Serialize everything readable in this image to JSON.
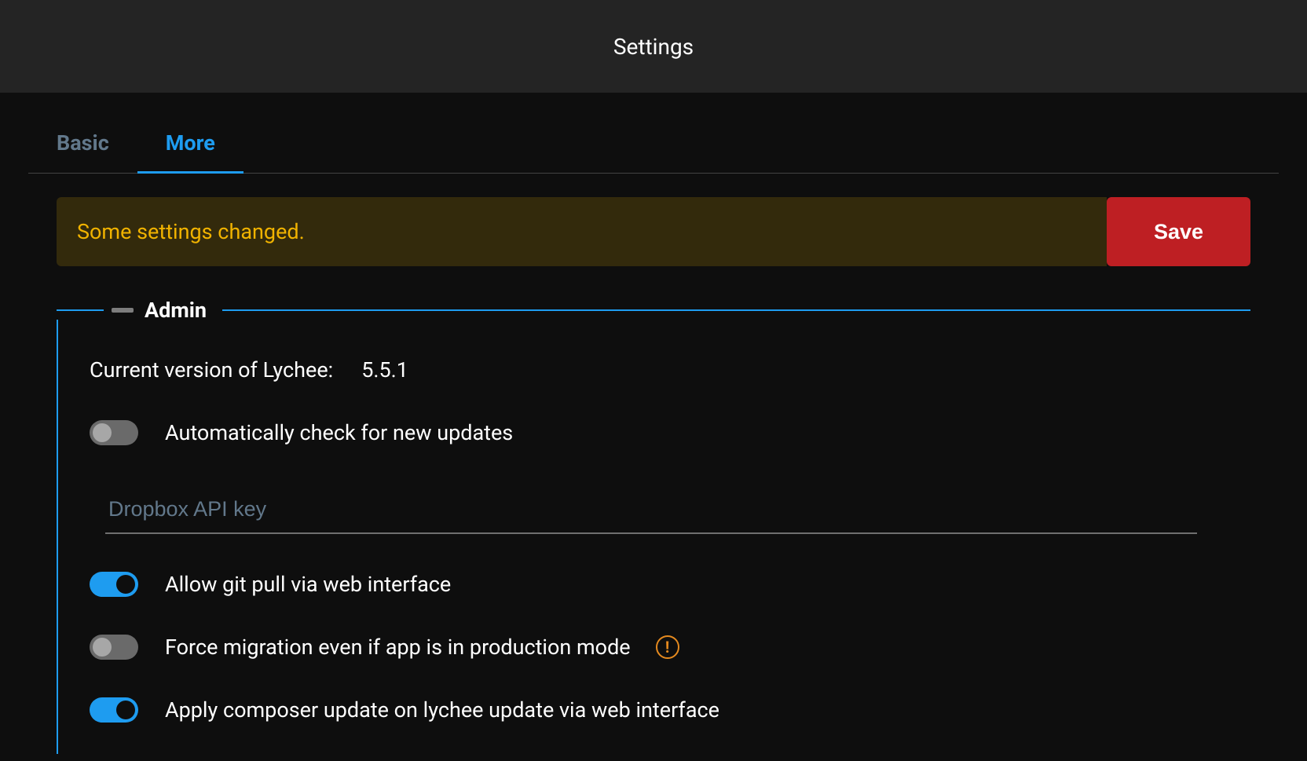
{
  "titlebar": {
    "title": "Settings"
  },
  "tabs": {
    "basic": "Basic",
    "more": "More"
  },
  "alert": {
    "message": "Some settings changed.",
    "save": "Save"
  },
  "admin": {
    "legend": "Admin",
    "version_label": "Current version of Lychee:",
    "version_value": "5.5.1",
    "auto_update_label": "Automatically check for new updates",
    "auto_update_on": false,
    "dropbox_placeholder": "Dropbox API key",
    "dropbox_value": "",
    "git_pull_label": "Allow git pull via web interface",
    "git_pull_on": true,
    "force_migration_label": "Force migration even if app is in production mode",
    "force_migration_on": false,
    "force_migration_warning": true,
    "composer_label": "Apply composer update on lychee update via web interface",
    "composer_on": true
  }
}
